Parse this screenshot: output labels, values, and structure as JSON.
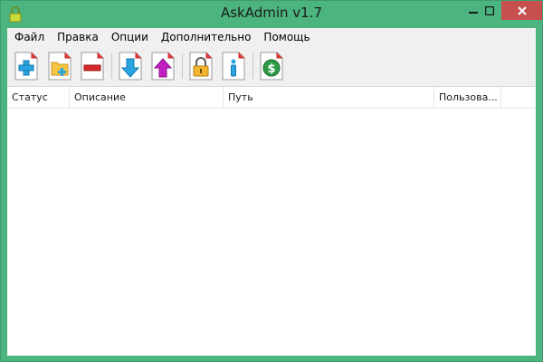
{
  "window": {
    "title": "AskAdmin v1.7"
  },
  "menu": [
    {
      "label": "Файл"
    },
    {
      "label": "Правка"
    },
    {
      "label": "Опции"
    },
    {
      "label": "Дополнительно"
    },
    {
      "label": "Помощь"
    }
  ],
  "toolbar": {
    "buttons": [
      {
        "icon": "add-file-icon"
      },
      {
        "icon": "add-folder-icon"
      },
      {
        "icon": "remove-icon"
      },
      {
        "icon": "import-down-icon"
      },
      {
        "icon": "export-up-icon"
      },
      {
        "icon": "lock-icon"
      },
      {
        "icon": "info-icon"
      },
      {
        "icon": "dollar-icon"
      }
    ]
  },
  "table": {
    "columns": [
      "Статус",
      "Описание",
      "Путь",
      "Пользова..."
    ],
    "rows": []
  },
  "colors": {
    "frame": "#4cb47e",
    "close_button": "#c74f4d",
    "toolbar_bg": "#f0f0f0"
  }
}
